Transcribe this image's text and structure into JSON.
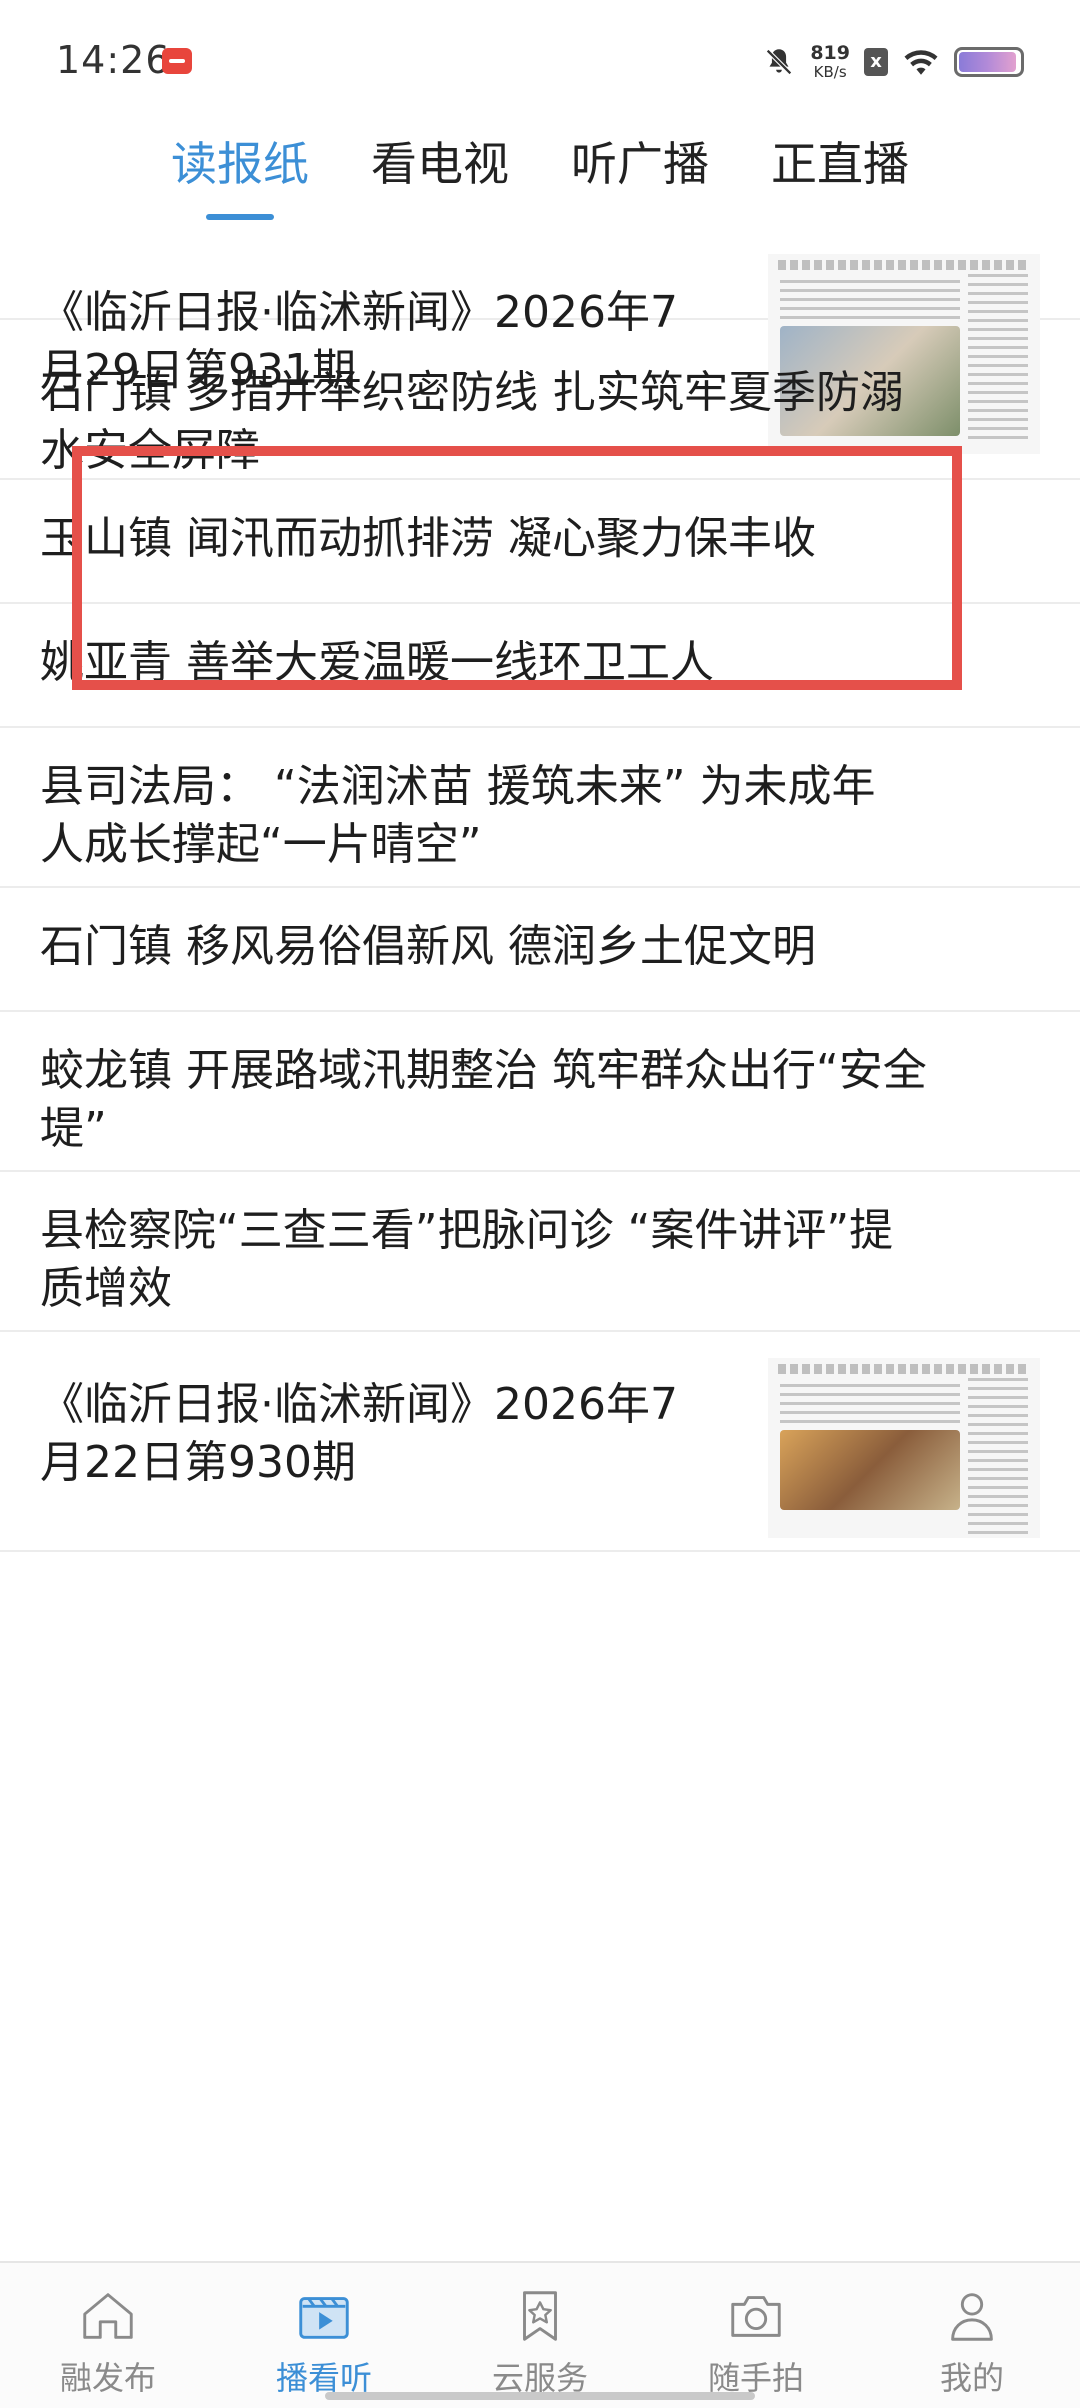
{
  "status_bar": {
    "time": "14:26",
    "net_speed_value": "819",
    "net_speed_unit": "KB/s",
    "sim_icon_text": "x",
    "battery_level": 0.95,
    "icons": [
      "app-notification-icon",
      "bell-off-icon",
      "sim-x-icon",
      "wifi-icon",
      "battery-icon"
    ]
  },
  "top_tabs": [
    {
      "label": "读报纸",
      "active": true
    },
    {
      "label": "看电视",
      "active": false
    },
    {
      "label": "听广播",
      "active": false
    },
    {
      "label": "正直播",
      "active": false
    }
  ],
  "feed": [
    {
      "lines": [
        "《临沂日报·临沭新闻》2026年7",
        "月29日第931期"
      ],
      "has_thumbnail": true
    },
    {
      "lines": [
        "石门镇  多措并举织密防线  扎实筑牢夏季防溺",
        "水安全屏障"
      ],
      "has_thumbnail": false,
      "highlighted": true
    },
    {
      "lines": [
        "玉山镇  闻汛而动抓排涝  凝心聚力保丰收"
      ],
      "has_thumbnail": false
    },
    {
      "lines": [
        "姚亚青  善举大爱温暖一线环卫工人"
      ],
      "has_thumbnail": false
    },
    {
      "lines": [
        "县司法局：  “法润沭苗  援筑未来”  为未成年",
        "人成长撑起“一片晴空”"
      ],
      "has_thumbnail": false
    },
    {
      "lines": [
        "石门镇  移风易俗倡新风  德润乡土促文明"
      ],
      "has_thumbnail": false
    },
    {
      "lines": [
        "蛟龙镇  开展路域汛期整治  筑牢群众出行“安全",
        "堤”"
      ],
      "has_thumbnail": false
    },
    {
      "lines": [
        "县检察院“三查三看”把脉问诊  “案件讲评”提",
        "质增效"
      ],
      "has_thumbnail": false
    },
    {
      "lines": [
        "《临沂日报·临沭新闻》2026年7",
        "月22日第930期"
      ],
      "has_thumbnail": true
    }
  ],
  "bottom_nav": [
    {
      "label": "融发布",
      "icon": "home-icon",
      "active": false
    },
    {
      "label": "播看听",
      "icon": "video-play-icon",
      "active": true
    },
    {
      "label": "云服务",
      "icon": "bookmark-star-icon",
      "active": false
    },
    {
      "label": "随手拍",
      "icon": "camera-icon",
      "active": false
    },
    {
      "label": "我的",
      "icon": "user-icon",
      "active": false
    }
  ],
  "colors": {
    "accent": "#3c8fd6",
    "highlight_box": "#e5504a",
    "text": "#1e1e1e",
    "muted": "#8a8a8a"
  }
}
